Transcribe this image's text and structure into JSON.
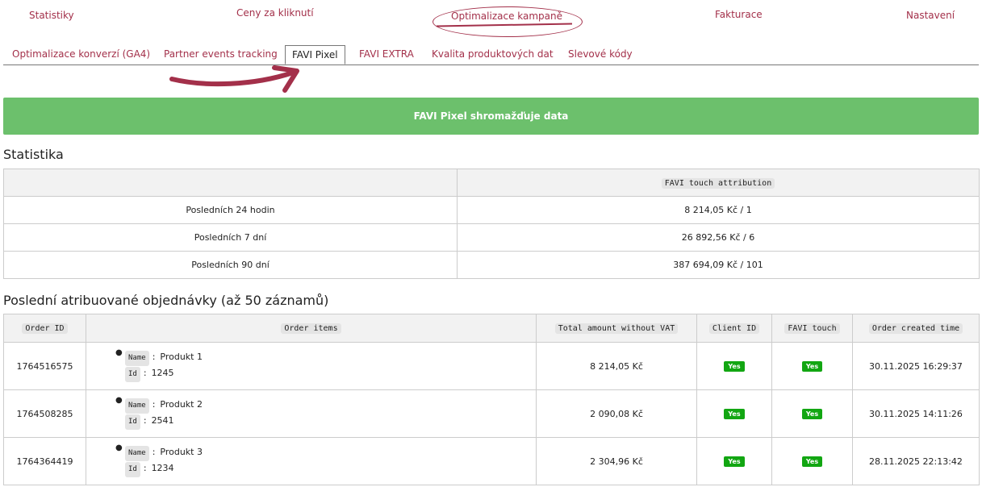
{
  "topnav": {
    "items": [
      "Statistiky",
      "Ceny za kliknutí",
      "Optimalizace kampaně",
      "Fakturace",
      "Nastavení"
    ]
  },
  "tabs": {
    "items": [
      "Optimalizace konverzí (GA4)",
      "Partner events tracking",
      "FAVI Pixel",
      "FAVI EXTRA",
      "Kvalita produktových dat",
      "Slevové kódy"
    ],
    "active": "FAVI Pixel"
  },
  "banner": {
    "text": "FAVI Pixel shromažďuje data",
    "color": "#6cc06c"
  },
  "stats": {
    "title": "Statistika",
    "header": "FAVI touch attribution",
    "rows": [
      {
        "period": "Posledních 24 hodin",
        "value": "8 214,05 Kč / 1"
      },
      {
        "period": "Posledních 7 dní",
        "value": "26 892,56 Kč / 6"
      },
      {
        "period": "Posledních 90 dní",
        "value": "387 694,09 Kč / 101"
      }
    ]
  },
  "orders": {
    "title": "Poslední atribuované objednávky (až 50 záznamů)",
    "columns": [
      "Order ID",
      "Order items",
      "Total amount without VAT",
      "Client ID",
      "FAVI touch",
      "Order created time"
    ],
    "item_keys": {
      "name": "Name",
      "id": "Id"
    },
    "rows": [
      {
        "order_id": "1764516575",
        "item_name": "Produkt 1",
        "item_id": "1245",
        "total": "8 214,05 Kč",
        "client_id": "Yes",
        "favi_touch": "Yes",
        "created": "30.11.2025 16:29:37"
      },
      {
        "order_id": "1764508285",
        "item_name": "Produkt 2",
        "item_id": "2541",
        "total": "2 090,08 Kč",
        "client_id": "Yes",
        "favi_touch": "Yes",
        "created": "30.11.2025 14:11:26"
      },
      {
        "order_id": "1764364419",
        "item_name": "Produkt 3",
        "item_id": "1234",
        "total": "2 304,96 Kč",
        "client_id": "Yes",
        "favi_touch": "Yes",
        "created": "28.11.2025 22:13:42"
      }
    ]
  },
  "colors": {
    "accent": "#a3304a",
    "success": "#12a612",
    "border": "#cccccc"
  }
}
